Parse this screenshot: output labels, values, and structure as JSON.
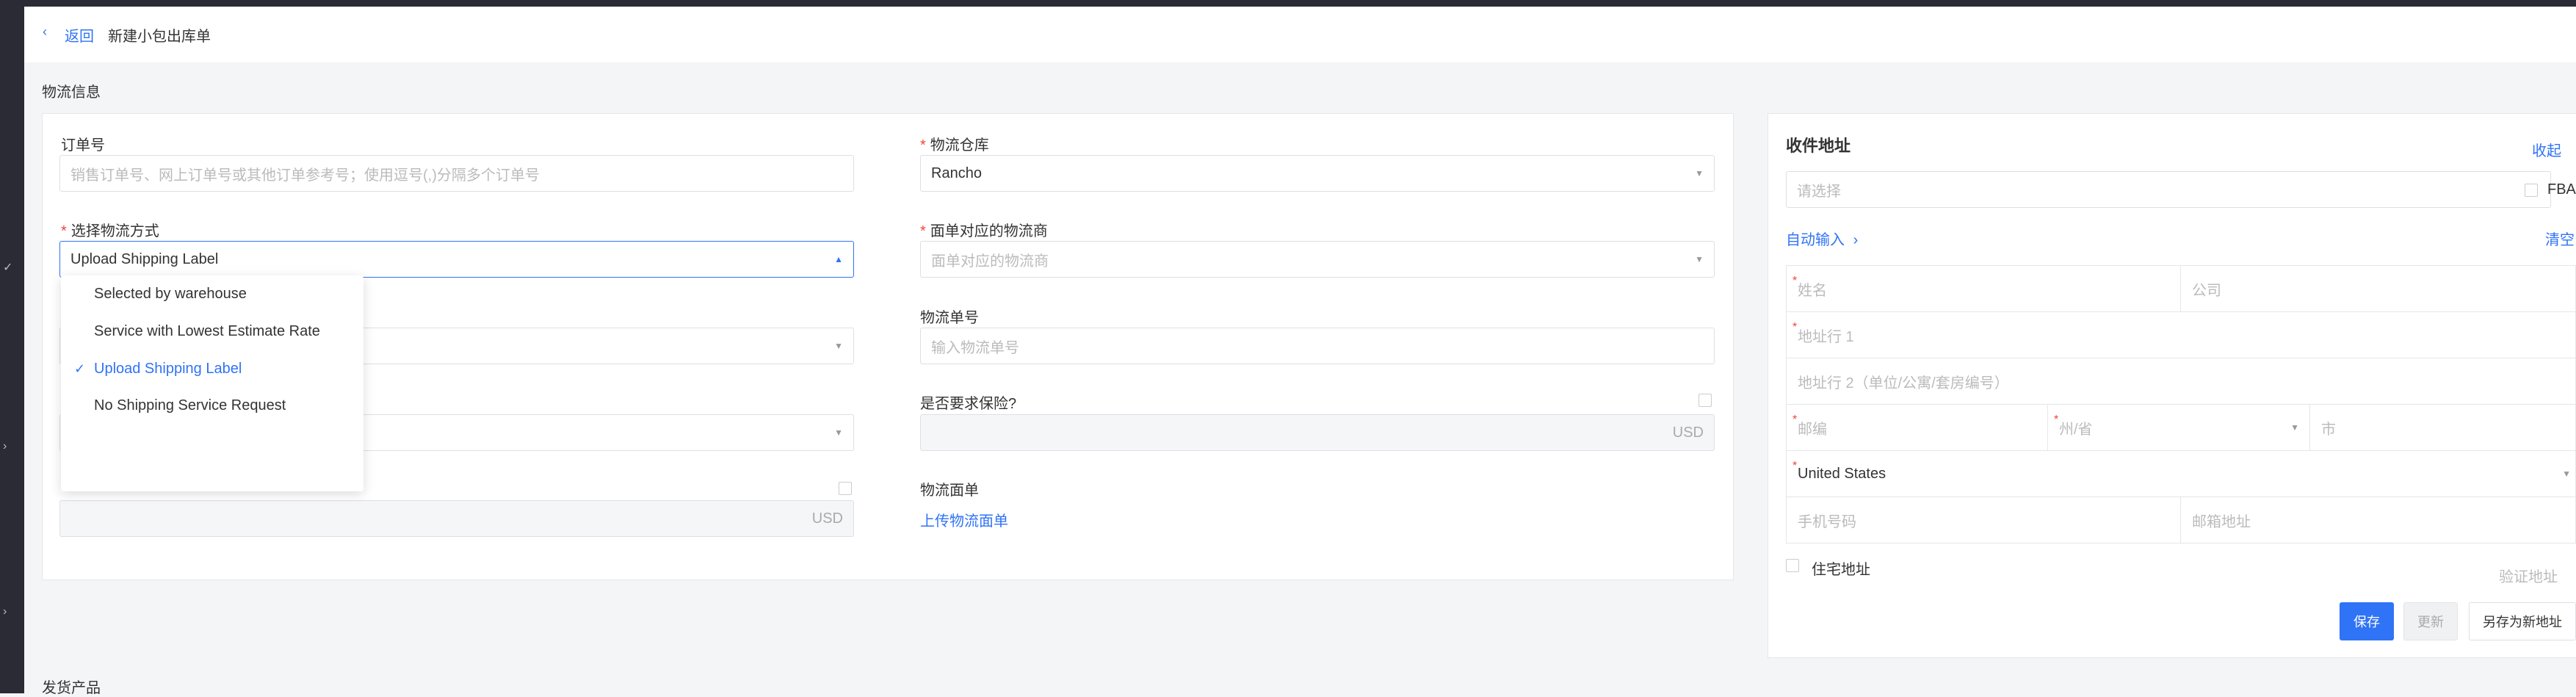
{
  "header": {
    "back_label": "返回",
    "title": "新建小包出库单"
  },
  "sections": {
    "logistics": "物流信息",
    "products": "发货产品"
  },
  "form": {
    "order_no": {
      "label": "订单号",
      "placeholder": "销售订单号、网上订单号或其他订单参考号；使用逗号(,)分隔多个订单号"
    },
    "warehouse": {
      "label": "物流仓库",
      "value": "Rancho"
    },
    "shipping_method": {
      "label": "选择物流方式",
      "value": "Upload Shipping Label"
    },
    "carrier": {
      "label": "面单对应的物流商",
      "placeholder": "面单对应的物流商"
    },
    "tracking_no": {
      "label": "物流单号",
      "placeholder": "输入物流单号"
    },
    "insurance": {
      "label": "是否要求保险?",
      "currency": "USD"
    },
    "left_amount": {
      "currency": "USD"
    },
    "label_upload": {
      "label": "物流面单",
      "link": "上传物流面单"
    }
  },
  "dropdown": {
    "options": [
      {
        "label": "Selected by warehouse",
        "selected": false
      },
      {
        "label": "Service with Lowest Estimate Rate",
        "selected": false
      },
      {
        "label": "Upload Shipping Label",
        "selected": true
      },
      {
        "label": "No Shipping Service Request",
        "selected": false
      }
    ]
  },
  "address": {
    "title": "收件地址",
    "collapse": "收起",
    "select_placeholder": "请选择",
    "fba_label": "FBA",
    "auto_input": "自动输入",
    "clear": "清空",
    "name_ph": "姓名",
    "company_ph": "公司",
    "addr1_ph": "地址行 1",
    "addr2_ph": "地址行 2（单位/公寓/套房编号）",
    "zip_ph": "邮编",
    "state_ph": "州/省",
    "city_ph": "市",
    "country": "United States",
    "phone_ph": "手机号码",
    "email_ph": "邮箱地址",
    "residential": "住宅地址",
    "verify": "验证地址",
    "save": "保存",
    "update": "更新",
    "save_new": "另存为新地址"
  },
  "colors": {
    "accent": "#2f73f6",
    "required": "#f0443a",
    "sidebar": "#2b2b36"
  }
}
